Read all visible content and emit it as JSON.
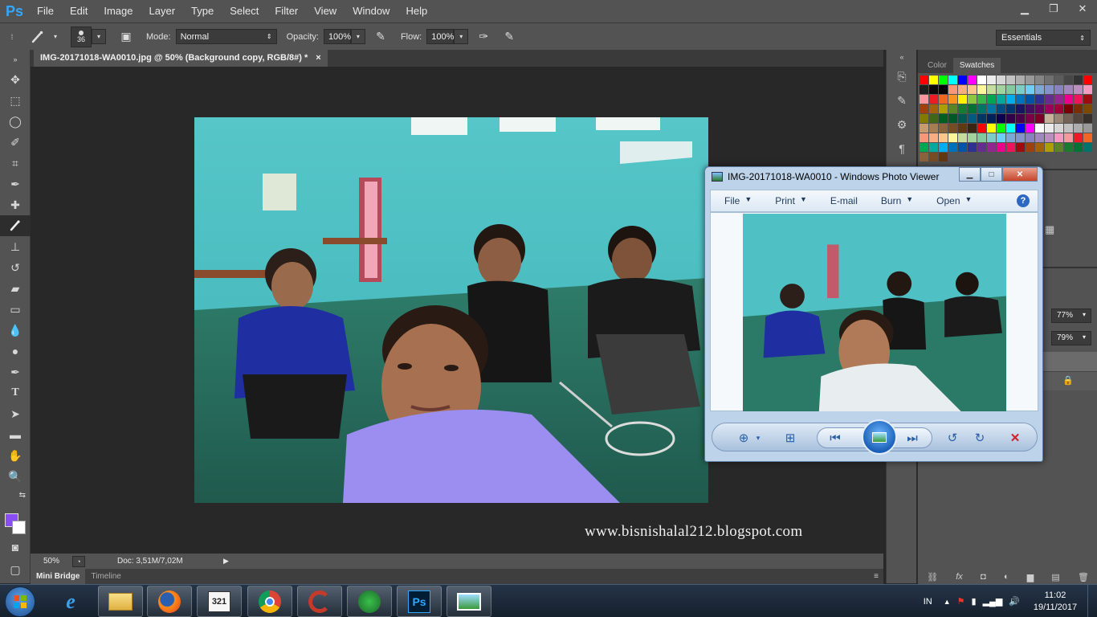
{
  "menubar": {
    "logo": "Ps",
    "items": [
      "File",
      "Edit",
      "Image",
      "Layer",
      "Type",
      "Select",
      "Filter",
      "View",
      "Window",
      "Help"
    ]
  },
  "options": {
    "brush_size": "36",
    "mode_label": "Mode:",
    "mode_value": "Normal",
    "opacity_label": "Opacity:",
    "opacity_value": "100%",
    "flow_label": "Flow:",
    "flow_value": "100%",
    "workspace": "Essentials"
  },
  "document": {
    "tab_title": "IMG-20171018-WA0010.jpg @ 50% (Background copy, RGB/8#) *",
    "close_glyph": "×",
    "zoom": "50%",
    "doc_info": "Doc: 3,51M/7,02M"
  },
  "watermark": "www.bisnishalal212.blogspot.com",
  "bottom_tabs": [
    "Mini Bridge",
    "Timeline"
  ],
  "right_panel": {
    "tabs": [
      "Color",
      "Swatches"
    ],
    "opacity_value": "77%",
    "fill_value": "79%"
  },
  "swatch_colors": [
    "#ff0000",
    "#ffff00",
    "#00ff00",
    "#00ffff",
    "#0000ff",
    "#ff00ff",
    "#ffffff",
    "#ebebeb",
    "#d6d6d6",
    "#c2c2c2",
    "#adadad",
    "#999999",
    "#858585",
    "#707070",
    "#5c5c5c",
    "#474747",
    "#333333",
    "#ff0000",
    "#1f1f1f",
    "#0a0a0a",
    "#000000",
    "#f7977a",
    "#f9ad81",
    "#fdc68a",
    "#fff79a",
    "#c4df9b",
    "#a2d39c",
    "#82ca9d",
    "#7bcdc8",
    "#6ecff6",
    "#7ea7d8",
    "#8493ca",
    "#8882be",
    "#a187be",
    "#bc8dbf",
    "#f49ac2",
    "#f6989d",
    "#ed1c24",
    "#f26522",
    "#f7941d",
    "#fff200",
    "#8dc73f",
    "#39b54a",
    "#00a651",
    "#00a99d",
    "#00aeef",
    "#0072bc",
    "#0054a6",
    "#2e3192",
    "#662d91",
    "#92278f",
    "#ec008c",
    "#ed145b",
    "#9e0b0f",
    "#a0410d",
    "#a36209",
    "#aba000",
    "#598527",
    "#197b30",
    "#007236",
    "#00746b",
    "#0076a3",
    "#004b80",
    "#003471",
    "#1b1464",
    "#440e62",
    "#630460",
    "#9e005d",
    "#9e0039",
    "#790000",
    "#7b2e00",
    "#7d4900",
    "#827b00",
    "#406618",
    "#005e20",
    "#005826",
    "#005952",
    "#005b7f",
    "#003663",
    "#002157",
    "#0d004c",
    "#32004b",
    "#4b0049",
    "#7b0046",
    "#7a0026",
    "#c7b299",
    "#998675",
    "#736357",
    "#534741",
    "#37302d",
    "#c69c6d",
    "#a67c52",
    "#8c6239",
    "#754c24",
    "#603913",
    "#3c2415",
    "#ff0000",
    "#ffff00",
    "#00ff00",
    "#00ffff",
    "#0000ff",
    "#ff00ff",
    "#ffffff",
    "#ebebeb",
    "#d6d6d6",
    "#c2c2c2",
    "#adadad",
    "#999999",
    "#f7977a",
    "#f9ad81",
    "#fdc68a",
    "#fff79a",
    "#c4df9b",
    "#a2d39c",
    "#82ca9d",
    "#7bcdc8",
    "#6ecff6",
    "#7ea7d8",
    "#8493ca",
    "#8882be",
    "#a187be",
    "#bc8dbf",
    "#f49ac2",
    "#f6989d",
    "#ed1c24",
    "#f26522",
    "#00a651",
    "#00a99d",
    "#00aeef",
    "#0072bc",
    "#0054a6",
    "#2e3192",
    "#662d91",
    "#92278f",
    "#ec008c",
    "#ed145b",
    "#9e0b0f",
    "#a0410d",
    "#a36209",
    "#aba000",
    "#598527",
    "#197b30",
    "#007236",
    "#00746b",
    "#8c6239",
    "#754c24",
    "#603913"
  ],
  "photo_viewer": {
    "title": "IMG-20171018-WA0010 - Windows Photo Viewer",
    "menu": [
      "File",
      "Print",
      "E-mail",
      "Burn",
      "Open"
    ],
    "help": "?"
  },
  "taskbar": {
    "language": "IN",
    "time": "11:02",
    "date": "19/11/2017",
    "apps": [
      "Windows Explorer",
      "Mozilla Firefox",
      "KMPlayer",
      "Google Chrome",
      "CCleaner",
      "Internet Download Manager",
      "Adobe Photoshop",
      "Windows Photo Viewer"
    ]
  },
  "colors": {
    "foreground": "#8a4cf3",
    "background": "#ffffff",
    "ps_blue": "#31a8ff"
  }
}
